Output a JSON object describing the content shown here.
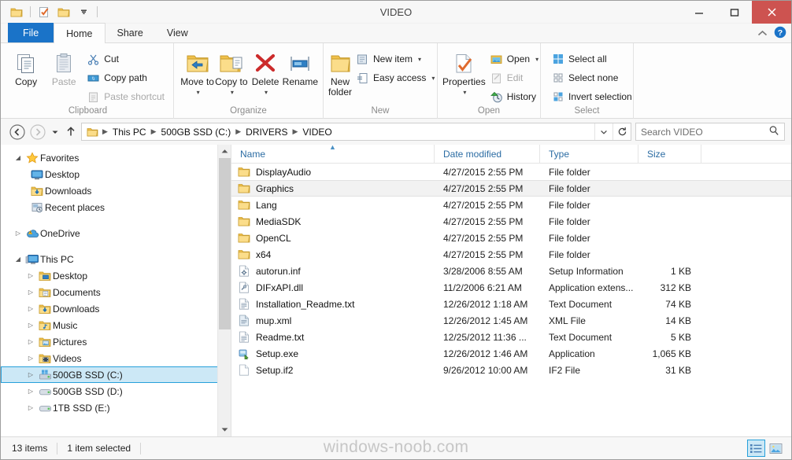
{
  "window": {
    "title": "VIDEO",
    "minimize_label": "Minimize",
    "maximize_label": "Maximize",
    "close_label": "Close"
  },
  "quick_access": {
    "items": [
      {
        "name": "properties-folder-icon",
        "label": "Properties"
      },
      {
        "name": "new-folder-icon",
        "label": "New folder"
      },
      {
        "name": "customize-folder-icon",
        "label": "Customize Quick Access Toolbar"
      },
      {
        "name": "chevron-down-icon",
        "label": "Customize"
      }
    ]
  },
  "tabs": [
    {
      "label": "File",
      "active": false,
      "file": true
    },
    {
      "label": "Home",
      "active": true,
      "file": false
    },
    {
      "label": "Share",
      "active": false,
      "file": false
    },
    {
      "label": "View",
      "active": false,
      "file": false
    }
  ],
  "tabstrip_right": {
    "collapse_label": "Minimize the Ribbon",
    "help_label": "Help"
  },
  "ribbon": {
    "groups": [
      {
        "title": "Clipboard",
        "big_buttons": [
          {
            "label": "Copy",
            "icon": "copy-icon",
            "dim": false
          },
          {
            "label": "Paste",
            "icon": "paste-icon",
            "dim": true
          }
        ],
        "small_buttons": [
          {
            "label": "Cut",
            "icon": "scissors-icon",
            "dim": false
          },
          {
            "label": "Copy path",
            "icon": "copy-path-icon",
            "dim": false
          },
          {
            "label": "Paste shortcut",
            "icon": "paste-shortcut-icon",
            "dim": true
          }
        ]
      },
      {
        "title": "Organize",
        "big_buttons": [
          {
            "label": "Move to",
            "icon": "move-to-icon",
            "dropdown": true
          },
          {
            "label": "Copy to",
            "icon": "copy-to-icon",
            "dropdown": true
          },
          {
            "label": "Delete",
            "icon": "delete-icon",
            "dropdown": true
          },
          {
            "label": "Rename",
            "icon": "rename-icon",
            "dropdown": false
          }
        ]
      },
      {
        "title": "New",
        "big_buttons": [
          {
            "label": "New folder",
            "icon": "new-folder-icon",
            "dropdown": false
          }
        ],
        "small_buttons": [
          {
            "label": "New item",
            "icon": "new-item-icon",
            "dropdown": true
          },
          {
            "label": "Easy access",
            "icon": "easy-access-icon",
            "dropdown": true
          }
        ]
      },
      {
        "title": "Open",
        "big_buttons": [
          {
            "label": "Properties",
            "icon": "properties-icon",
            "dropdown": true
          }
        ],
        "small_buttons": [
          {
            "label": "Open",
            "icon": "open-icon",
            "dropdown": true,
            "dim": false
          },
          {
            "label": "Edit",
            "icon": "edit-icon",
            "dropdown": false,
            "dim": true
          },
          {
            "label": "History",
            "icon": "history-icon",
            "dropdown": false,
            "dim": false
          }
        ]
      },
      {
        "title": "Select",
        "small_buttons": [
          {
            "label": "Select all",
            "icon": "select-all-icon"
          },
          {
            "label": "Select none",
            "icon": "select-none-icon"
          },
          {
            "label": "Invert selection",
            "icon": "invert-selection-icon"
          }
        ]
      }
    ]
  },
  "address_bar": {
    "back_label": "Back",
    "forward_label": "Forward",
    "recent_label": "Recent locations",
    "up_label": "Up",
    "breadcrumbs": [
      "This PC",
      "500GB SSD (C:)",
      "DRIVERS",
      "VIDEO"
    ],
    "dropdown_label": "Previous locations",
    "refresh_label": "Refresh",
    "search": {
      "placeholder": "Search VIDEO",
      "value": ""
    }
  },
  "nav_pane": {
    "items": [
      {
        "label": "Favorites",
        "icon": "star-icon",
        "indent": 0,
        "expander": "open",
        "selected": false
      },
      {
        "label": "Desktop",
        "icon": "desktop-icon",
        "indent": 1,
        "expander": "none",
        "selected": false
      },
      {
        "label": "Downloads",
        "icon": "downloads-icon",
        "indent": 1,
        "expander": "none",
        "selected": false
      },
      {
        "label": "Recent places",
        "icon": "recent-places-icon",
        "indent": 1,
        "expander": "none",
        "selected": false
      },
      {
        "gap": true
      },
      {
        "label": "OneDrive",
        "icon": "onedrive-icon",
        "indent": 0,
        "expander": "closed",
        "selected": false
      },
      {
        "gap": true
      },
      {
        "label": "This PC",
        "icon": "this-pc-icon",
        "indent": 0,
        "expander": "open",
        "selected": false
      },
      {
        "label": "Desktop",
        "icon": "folder-desktop-icon",
        "indent": 1,
        "expander": "closed",
        "selected": false
      },
      {
        "label": "Documents",
        "icon": "folder-documents-icon",
        "indent": 1,
        "expander": "closed",
        "selected": false
      },
      {
        "label": "Downloads",
        "icon": "folder-downloads-icon",
        "indent": 1,
        "expander": "closed",
        "selected": false
      },
      {
        "label": "Music",
        "icon": "folder-music-icon",
        "indent": 1,
        "expander": "closed",
        "selected": false
      },
      {
        "label": "Pictures",
        "icon": "folder-pictures-icon",
        "indent": 1,
        "expander": "closed",
        "selected": false
      },
      {
        "label": "Videos",
        "icon": "folder-videos-icon",
        "indent": 1,
        "expander": "closed",
        "selected": false
      },
      {
        "label": "500GB SSD (C:)",
        "icon": "system-drive-icon",
        "indent": 1,
        "expander": "closed",
        "selected": true
      },
      {
        "label": "500GB SSD (D:)",
        "icon": "drive-icon",
        "indent": 1,
        "expander": "closed",
        "selected": false
      },
      {
        "label": "1TB SSD (E:)",
        "icon": "drive-icon",
        "indent": 1,
        "expander": "closed",
        "selected": false
      }
    ],
    "scrollbar": {
      "up_label": "Scroll up",
      "down_label": "Scroll down"
    }
  },
  "file_list": {
    "columns": [
      {
        "key": "name",
        "label": "Name",
        "sorted": "asc"
      },
      {
        "key": "date",
        "label": "Date modified",
        "sorted": ""
      },
      {
        "key": "type",
        "label": "Type",
        "sorted": ""
      },
      {
        "key": "size",
        "label": "Size",
        "sorted": ""
      }
    ],
    "rows": [
      {
        "name": "DisplayAudio",
        "date": "4/27/2015 2:55 PM",
        "type": "File folder",
        "size": "",
        "icon": "folder-icon",
        "selected": false
      },
      {
        "name": "Graphics",
        "date": "4/27/2015 2:55 PM",
        "type": "File folder",
        "size": "",
        "icon": "folder-icon",
        "selected": true
      },
      {
        "name": "Lang",
        "date": "4/27/2015 2:55 PM",
        "type": "File folder",
        "size": "",
        "icon": "folder-icon",
        "selected": false
      },
      {
        "name": "MediaSDK",
        "date": "4/27/2015 2:55 PM",
        "type": "File folder",
        "size": "",
        "icon": "folder-icon",
        "selected": false
      },
      {
        "name": "OpenCL",
        "date": "4/27/2015 2:55 PM",
        "type": "File folder",
        "size": "",
        "icon": "folder-icon",
        "selected": false
      },
      {
        "name": "x64",
        "date": "4/27/2015 2:55 PM",
        "type": "File folder",
        "size": "",
        "icon": "folder-icon",
        "selected": false
      },
      {
        "name": "autorun.inf",
        "date": "3/28/2006 8:55 AM",
        "type": "Setup Information",
        "size": "1 KB",
        "icon": "setup-information-icon",
        "selected": false
      },
      {
        "name": "DIFxAPI.dll",
        "date": "11/2/2006 6:21 AM",
        "type": "Application extens...",
        "size": "312 KB",
        "icon": "dll-icon",
        "selected": false
      },
      {
        "name": "Installation_Readme.txt",
        "date": "12/26/2012 1:18 AM",
        "type": "Text Document",
        "size": "74 KB",
        "icon": "text-document-icon",
        "selected": false
      },
      {
        "name": "mup.xml",
        "date": "12/26/2012 1:45 AM",
        "type": "XML File",
        "size": "14 KB",
        "icon": "xml-file-icon",
        "selected": false
      },
      {
        "name": "Readme.txt",
        "date": "12/25/2012 11:36 ...",
        "type": "Text Document",
        "size": "5 KB",
        "icon": "text-document-icon",
        "selected": false
      },
      {
        "name": "Setup.exe",
        "date": "12/26/2012 1:46 AM",
        "type": "Application",
        "size": "1,065 KB",
        "icon": "application-icon",
        "selected": false
      },
      {
        "name": "Setup.if2",
        "date": "9/26/2012 10:00 AM",
        "type": "IF2 File",
        "size": "31 KB",
        "icon": "generic-file-icon",
        "selected": false
      }
    ]
  },
  "status_bar": {
    "item_count": "13 items",
    "selection": "1 item selected",
    "views": [
      {
        "name": "details-view-button",
        "label": "Details view",
        "active": true
      },
      {
        "name": "large-icons-view-button",
        "label": "Large icons view",
        "active": false
      }
    ]
  },
  "watermark": {
    "text": "windows-noob.com"
  },
  "colors": {
    "accent": "#1a73c8",
    "selection_fill": "#cce8f6",
    "selection_border": "#26a0da",
    "close_button": "#cd5350",
    "header_text": "#2b6ca3",
    "folder_yellow": "#f6cf74"
  }
}
